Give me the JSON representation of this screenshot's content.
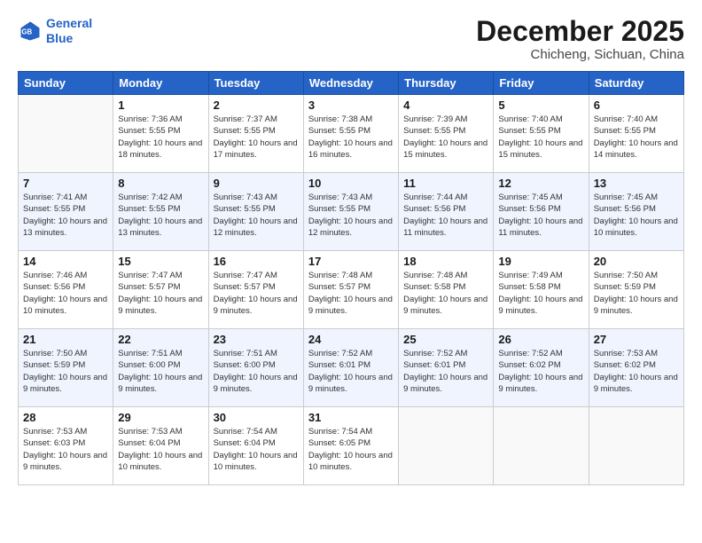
{
  "header": {
    "logo_line1": "General",
    "logo_line2": "Blue",
    "title": "December 2025",
    "subtitle": "Chicheng, Sichuan, China"
  },
  "days_of_week": [
    "Sunday",
    "Monday",
    "Tuesday",
    "Wednesday",
    "Thursday",
    "Friday",
    "Saturday"
  ],
  "weeks": [
    [
      {
        "day": "",
        "info": ""
      },
      {
        "day": "1",
        "info": "Sunrise: 7:36 AM\nSunset: 5:55 PM\nDaylight: 10 hours\nand 18 minutes."
      },
      {
        "day": "2",
        "info": "Sunrise: 7:37 AM\nSunset: 5:55 PM\nDaylight: 10 hours\nand 17 minutes."
      },
      {
        "day": "3",
        "info": "Sunrise: 7:38 AM\nSunset: 5:55 PM\nDaylight: 10 hours\nand 16 minutes."
      },
      {
        "day": "4",
        "info": "Sunrise: 7:39 AM\nSunset: 5:55 PM\nDaylight: 10 hours\nand 15 minutes."
      },
      {
        "day": "5",
        "info": "Sunrise: 7:40 AM\nSunset: 5:55 PM\nDaylight: 10 hours\nand 15 minutes."
      },
      {
        "day": "6",
        "info": "Sunrise: 7:40 AM\nSunset: 5:55 PM\nDaylight: 10 hours\nand 14 minutes."
      }
    ],
    [
      {
        "day": "7",
        "info": "Sunrise: 7:41 AM\nSunset: 5:55 PM\nDaylight: 10 hours\nand 13 minutes."
      },
      {
        "day": "8",
        "info": "Sunrise: 7:42 AM\nSunset: 5:55 PM\nDaylight: 10 hours\nand 13 minutes."
      },
      {
        "day": "9",
        "info": "Sunrise: 7:43 AM\nSunset: 5:55 PM\nDaylight: 10 hours\nand 12 minutes."
      },
      {
        "day": "10",
        "info": "Sunrise: 7:43 AM\nSunset: 5:55 PM\nDaylight: 10 hours\nand 12 minutes."
      },
      {
        "day": "11",
        "info": "Sunrise: 7:44 AM\nSunset: 5:56 PM\nDaylight: 10 hours\nand 11 minutes."
      },
      {
        "day": "12",
        "info": "Sunrise: 7:45 AM\nSunset: 5:56 PM\nDaylight: 10 hours\nand 11 minutes."
      },
      {
        "day": "13",
        "info": "Sunrise: 7:45 AM\nSunset: 5:56 PM\nDaylight: 10 hours\nand 10 minutes."
      }
    ],
    [
      {
        "day": "14",
        "info": "Sunrise: 7:46 AM\nSunset: 5:56 PM\nDaylight: 10 hours\nand 10 minutes."
      },
      {
        "day": "15",
        "info": "Sunrise: 7:47 AM\nSunset: 5:57 PM\nDaylight: 10 hours\nand 9 minutes."
      },
      {
        "day": "16",
        "info": "Sunrise: 7:47 AM\nSunset: 5:57 PM\nDaylight: 10 hours\nand 9 minutes."
      },
      {
        "day": "17",
        "info": "Sunrise: 7:48 AM\nSunset: 5:57 PM\nDaylight: 10 hours\nand 9 minutes."
      },
      {
        "day": "18",
        "info": "Sunrise: 7:48 AM\nSunset: 5:58 PM\nDaylight: 10 hours\nand 9 minutes."
      },
      {
        "day": "19",
        "info": "Sunrise: 7:49 AM\nSunset: 5:58 PM\nDaylight: 10 hours\nand 9 minutes."
      },
      {
        "day": "20",
        "info": "Sunrise: 7:50 AM\nSunset: 5:59 PM\nDaylight: 10 hours\nand 9 minutes."
      }
    ],
    [
      {
        "day": "21",
        "info": "Sunrise: 7:50 AM\nSunset: 5:59 PM\nDaylight: 10 hours\nand 9 minutes."
      },
      {
        "day": "22",
        "info": "Sunrise: 7:51 AM\nSunset: 6:00 PM\nDaylight: 10 hours\nand 9 minutes."
      },
      {
        "day": "23",
        "info": "Sunrise: 7:51 AM\nSunset: 6:00 PM\nDaylight: 10 hours\nand 9 minutes."
      },
      {
        "day": "24",
        "info": "Sunrise: 7:52 AM\nSunset: 6:01 PM\nDaylight: 10 hours\nand 9 minutes."
      },
      {
        "day": "25",
        "info": "Sunrise: 7:52 AM\nSunset: 6:01 PM\nDaylight: 10 hours\nand 9 minutes."
      },
      {
        "day": "26",
        "info": "Sunrise: 7:52 AM\nSunset: 6:02 PM\nDaylight: 10 hours\nand 9 minutes."
      },
      {
        "day": "27",
        "info": "Sunrise: 7:53 AM\nSunset: 6:02 PM\nDaylight: 10 hours\nand 9 minutes."
      }
    ],
    [
      {
        "day": "28",
        "info": "Sunrise: 7:53 AM\nSunset: 6:03 PM\nDaylight: 10 hours\nand 9 minutes."
      },
      {
        "day": "29",
        "info": "Sunrise: 7:53 AM\nSunset: 6:04 PM\nDaylight: 10 hours\nand 10 minutes."
      },
      {
        "day": "30",
        "info": "Sunrise: 7:54 AM\nSunset: 6:04 PM\nDaylight: 10 hours\nand 10 minutes."
      },
      {
        "day": "31",
        "info": "Sunrise: 7:54 AM\nSunset: 6:05 PM\nDaylight: 10 hours\nand 10 minutes."
      },
      {
        "day": "",
        "info": ""
      },
      {
        "day": "",
        "info": ""
      },
      {
        "day": "",
        "info": ""
      }
    ]
  ]
}
